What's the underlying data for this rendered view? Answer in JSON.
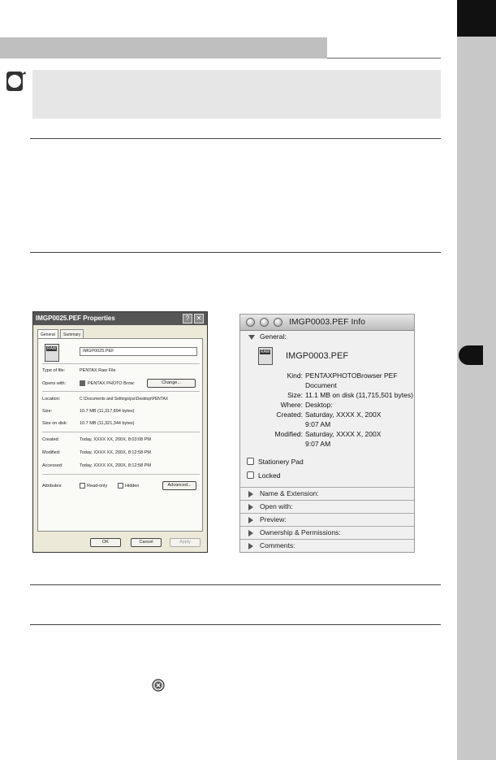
{
  "windows_dialog": {
    "title": "IMGP0025.PEF Properties",
    "help_btn": "?",
    "close_btn": "✕",
    "tabs": [
      "General",
      "Summary"
    ],
    "filename": "IMGP0025.PEF",
    "rows_a": [
      {
        "label": "Type of file:",
        "value": "PENTAX Raw File"
      },
      {
        "label": "Opens with:",
        "value": "PENTAX PHOTO Brow:"
      }
    ],
    "change_button": "Change...",
    "rows_b": [
      {
        "label": "Location:",
        "value": "C:\\Documents and Settings\\jss\\Desktop\\PENTAX"
      },
      {
        "label": "Size:",
        "value": "10.7 MB (11,317,894 bytes)"
      },
      {
        "label": "Size on disk:",
        "value": "10.7 MB (11,321,344 bytes)"
      }
    ],
    "rows_c": [
      {
        "label": "Created:",
        "value": "Today, XXXX XX, 200X, 8:03:08 PM"
      },
      {
        "label": "Modified:",
        "value": "Today, XXXX XX, 200X, 8:12:58 PM"
      },
      {
        "label": "Accessed:",
        "value": "Today, XXXX XX, 200X, 8:12:58 PM"
      }
    ],
    "attributes_label": "Attributes:",
    "readonly_label": "Read-only",
    "hidden_label": "Hidden",
    "advanced_button": "Advanced...",
    "ok_button": "OK",
    "cancel_button": "Cancel",
    "apply_button": "Apply"
  },
  "mac_dialog": {
    "title": "IMGP0003.PEF Info",
    "general_label": "General:",
    "filename": "IMGP0003.PEF",
    "kind_label": "Kind:",
    "kind_value": "PENTAXPHOTOBrowser PEF",
    "kind_value2": "Document",
    "size_label": "Size:",
    "size_value": "11.1 MB on disk (11,715,501 bytes)",
    "where_label": "Where:",
    "where_value": "Desktop:",
    "created_label": "Created:",
    "created_value": "Saturday, XXXX X, 200X",
    "created_time": "9:07 AM",
    "modified_label": "Modified:",
    "modified_value": "Saturday, XXXX X, 200X",
    "modified_time": "9:07 AM",
    "stationery_label": "Stationery Pad",
    "locked_label": "Locked",
    "sections": [
      "Name & Extension:",
      "Open with:",
      "Preview:",
      "Ownership & Permissions:",
      "Comments:"
    ]
  }
}
